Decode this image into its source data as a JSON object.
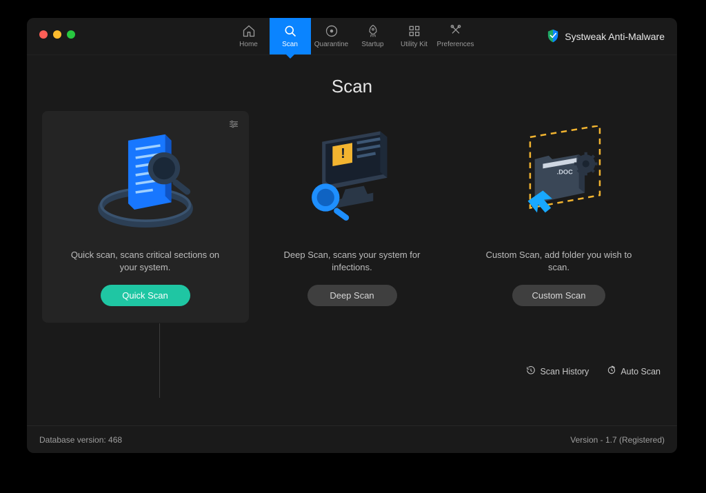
{
  "brand": {
    "name": "Systweak Anti-Malware"
  },
  "nav": {
    "home": "Home",
    "scan": "Scan",
    "quarantine": "Quarantine",
    "startup": "Startup",
    "utility": "Utility Kit",
    "preferences": "Preferences"
  },
  "page": {
    "title": "Scan"
  },
  "cards": {
    "quick": {
      "desc": "Quick scan, scans critical sections on your system.",
      "button": "Quick Scan"
    },
    "deep": {
      "desc": "Deep Scan, scans your system for infections.",
      "button": "Deep Scan"
    },
    "custom": {
      "desc": "Custom Scan, add folder you wish to scan.",
      "button": "Custom Scan"
    }
  },
  "links": {
    "history": "Scan History",
    "auto": "Auto Scan"
  },
  "footer": {
    "db": "Database version: 468",
    "version": "Version  -  1.7 (Registered)"
  }
}
